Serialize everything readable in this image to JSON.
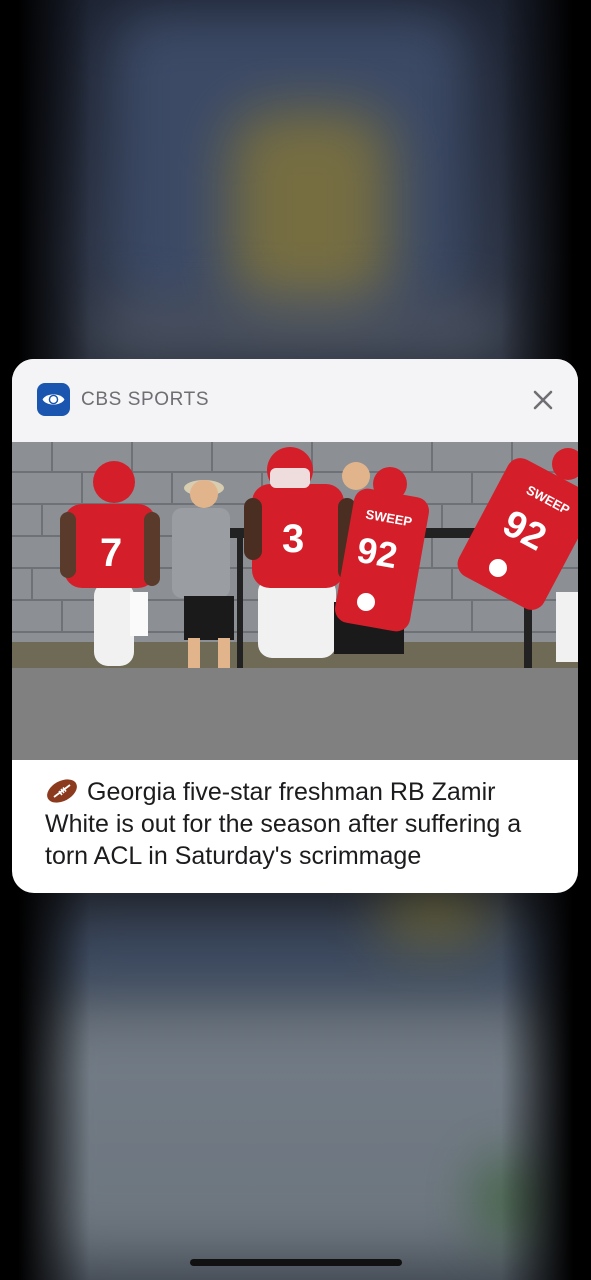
{
  "notification": {
    "app_name": "CBS SPORTS",
    "app_icon": "cbs-eye-icon",
    "close_icon": "close-icon",
    "message_emoji": "football-icon",
    "message": "Georgia five-star freshman RB Zamir White is out for the season after suffering a torn ACL in Saturday's scrimmage",
    "image": {
      "jersey_numbers": [
        "7",
        "3",
        "92",
        "92"
      ],
      "pad_labels": [
        "SWEEP",
        "SWEEP"
      ]
    }
  },
  "colors": {
    "brand_blue": "#1a56b0",
    "jersey_red": "#d41f2b"
  }
}
